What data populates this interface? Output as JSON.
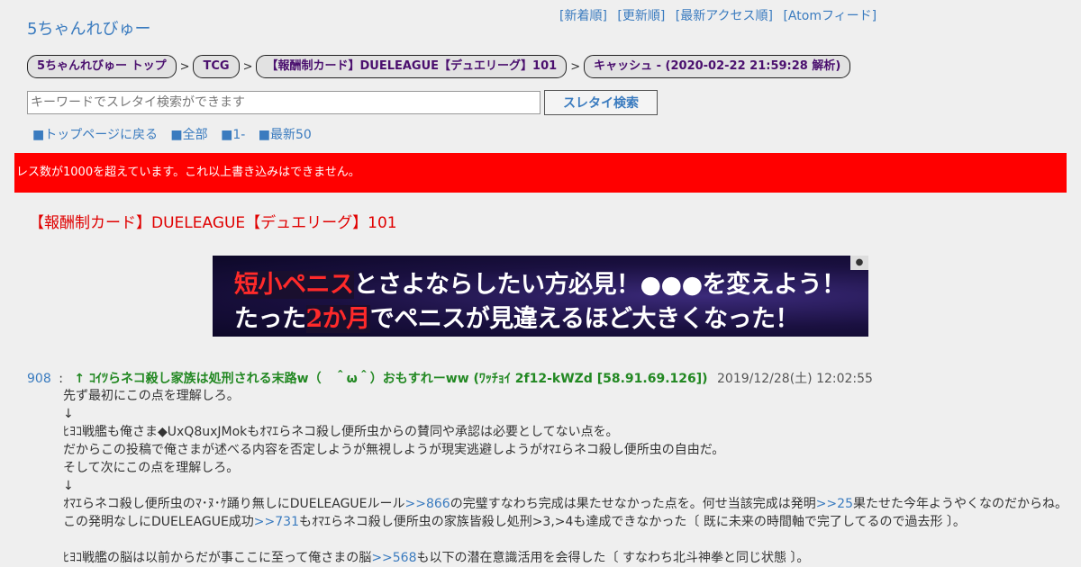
{
  "site": {
    "title": "5ちゃんれびゅー"
  },
  "top_links": [
    "[新着順]",
    "[更新順]",
    "[最新アクセス順]",
    "[Atomフィード]"
  ],
  "breadcrumb": {
    "items": [
      "5ちゃんれびゅー トップ",
      "TCG",
      "【報酬制カード】DUELEAGUE【デュエリーグ】101",
      "キャッシュ - (2020-02-22 21:59:28 解析)"
    ],
    "separator": ">"
  },
  "search": {
    "placeholder": "キーワードでスレタイ検索ができます",
    "button_label": "スレタイ検索"
  },
  "nav": {
    "back_top": "■トップページに戻る",
    "all": "■全部",
    "first": "■1-",
    "latest50": "■最新50"
  },
  "alert": {
    "text": "レス数が1000を超えています。これ以上書き込みはできません。",
    "color": "#ff0000"
  },
  "thread": {
    "title": "【報酬制カード】DUELEAGUE【デュエリーグ】101"
  },
  "ad": {
    "line1_highlight": "短小ペニス",
    "line1_rest": "とさよならしたい方必見！●●●を変えよう！",
    "line2_pre": "たった",
    "line2_highlight": "2か月",
    "line2_rest": "でペニスが見違えるほど大きくなった！"
  },
  "post": {
    "number": "908",
    "number_sep": ":",
    "name": "↑ ｺｲﾂらネコ殺し家族は処刑される末路w（　＾ω＾）おもすれーww (ﾜｯﾁｮｲ 2f12-kWZd [58.91.69.126])",
    "date": "2019/12/28(土) 12:02:55",
    "lines": {
      "l1": "先ず最初にこの点を理解しろ。",
      "l2": "↓",
      "l3": "ﾋﾖｺ戦艦も俺さま◆UxQ8uxJMokもｵﾏｴらネコ殺し便所虫からの賛同や承認は必要としてない点を。",
      "l4": "だからこの投稿で俺さまが述べる内容を否定しようが無視しようが現実逃避しようがｵﾏｴらネコ殺し便所虫の自由だ。",
      "l5": "そして次にこの点を理解しろ。",
      "l6": "↓",
      "l7a": "ｵﾏｴらネコ殺し便所虫のﾏ･ﾇ･ｹ踊り無しにDUELEAGUEルール",
      "l7_link1": ">>866",
      "l7b": "の完璧すなわち完成は果たせなかった点を。何せ当該完成は発明",
      "l7_link2": ">>25",
      "l7c": "果たせた今年ようやくなのだからね。",
      "l8a": "この発明なしにDUELEAGUE成功",
      "l8_link": ">>731",
      "l8b": "もｵﾏｴらネコ殺し便所虫の家族皆殺し処刑>3,>4も達成できなかった〔 既に未来の時間軸で完了してるので過去形 〕。",
      "l9": "",
      "l10a": "ﾋﾖｺ戦艦の脳は以前からだが事ここに至って俺さまの脳",
      "l10_link": ">>568",
      "l10b": "も以下の潜在意識活用を会得した〔 すなわち北斗神拳と同じ状態 〕。"
    }
  }
}
